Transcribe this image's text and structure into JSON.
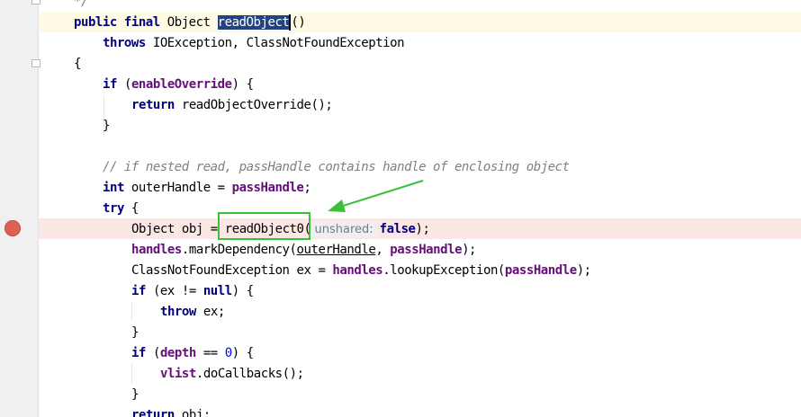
{
  "editor": {
    "lines": [
      {
        "indent": 1,
        "tokens": [
          {
            "t": "*/",
            "c": "cmt"
          }
        ]
      },
      {
        "indent": 1,
        "tokens": [
          {
            "t": "public",
            "c": "kw"
          },
          {
            "t": " "
          },
          {
            "t": "final",
            "c": "kw"
          },
          {
            "t": " Object "
          },
          {
            "t": "readObject",
            "c": "sel"
          },
          {
            "caret": true
          },
          {
            "t": "()"
          }
        ]
      },
      {
        "indent": 2,
        "tokens": [
          {
            "t": "throws",
            "c": "kw"
          },
          {
            "t": " IOException, ClassNotFoundException"
          }
        ]
      },
      {
        "indent": 1,
        "tokens": [
          {
            "t": "{"
          }
        ]
      },
      {
        "indent": 2,
        "tokens": [
          {
            "t": "if",
            "c": "kw"
          },
          {
            "t": " ("
          },
          {
            "t": "enableOverride",
            "c": "fld"
          },
          {
            "t": ") {"
          }
        ]
      },
      {
        "indent": 3,
        "tokens": [
          {
            "t": "return",
            "c": "kw"
          },
          {
            "t": " readObjectOverride();"
          }
        ]
      },
      {
        "indent": 2,
        "tokens": [
          {
            "t": "}"
          }
        ]
      },
      {
        "indent": 2,
        "tokens": []
      },
      {
        "indent": 2,
        "tokens": [
          {
            "t": "// if nested read, passHandle contains handle of enclosing object",
            "c": "cmt"
          }
        ]
      },
      {
        "indent": 2,
        "tokens": [
          {
            "t": "int",
            "c": "kw"
          },
          {
            "t": " outerHandle = "
          },
          {
            "t": "passHandle",
            "c": "fld"
          },
          {
            "t": ";"
          }
        ]
      },
      {
        "indent": 2,
        "tokens": [
          {
            "t": "try",
            "c": "kw"
          },
          {
            "t": " {"
          }
        ]
      },
      {
        "indent": 3,
        "tokens": [
          {
            "t": "Object obj = "
          },
          {
            "t": "readObject0("
          },
          {
            "hint": "unshared:"
          },
          {
            "t": "false",
            "c": "kw"
          },
          {
            "t": ");"
          }
        ]
      },
      {
        "indent": 3,
        "tokens": [
          {
            "t": "handles",
            "c": "fld"
          },
          {
            "t": ".markDependency("
          },
          {
            "t": "outerHandle",
            "c": "ul"
          },
          {
            "t": ", "
          },
          {
            "t": "passHandle",
            "c": "fld"
          },
          {
            "t": ");"
          }
        ]
      },
      {
        "indent": 3,
        "tokens": [
          {
            "t": "ClassNotFoundException ex = "
          },
          {
            "t": "handles",
            "c": "fld"
          },
          {
            "t": ".lookupException("
          },
          {
            "t": "passHandle",
            "c": "fld"
          },
          {
            "t": ");"
          }
        ]
      },
      {
        "indent": 3,
        "tokens": [
          {
            "t": "if",
            "c": "kw"
          },
          {
            "t": " (ex != "
          },
          {
            "t": "null",
            "c": "kw"
          },
          {
            "t": ") {"
          }
        ]
      },
      {
        "indent": 4,
        "tokens": [
          {
            "t": "throw",
            "c": "kw"
          },
          {
            "t": " ex;"
          }
        ]
      },
      {
        "indent": 3,
        "tokens": [
          {
            "t": "}"
          }
        ]
      },
      {
        "indent": 3,
        "tokens": [
          {
            "t": "if",
            "c": "kw"
          },
          {
            "t": " ("
          },
          {
            "t": "depth",
            "c": "fld"
          },
          {
            "t": " == "
          },
          {
            "t": "0",
            "c": "num"
          },
          {
            "t": ") {"
          }
        ]
      },
      {
        "indent": 4,
        "tokens": [
          {
            "t": "vlist",
            "c": "fld"
          },
          {
            "t": ".doCallbacks();"
          }
        ]
      },
      {
        "indent": 3,
        "tokens": [
          {
            "t": "}"
          }
        ]
      },
      {
        "indent": 3,
        "tokens": [
          {
            "t": "return",
            "c": "kw"
          },
          {
            "t": " obj;"
          }
        ]
      }
    ]
  },
  "gutter": {
    "breakpoint_line": 12,
    "breakpoint_icon": "breakpoint-dot-icon",
    "fold_icon": "fold-marker-icon"
  },
  "annotation": {
    "box_color": "#3ac13a",
    "arrow_color": "#3ac13a"
  },
  "colors": {
    "keyword": "#000080",
    "field": "#660e7a",
    "comment": "#808080",
    "number": "#0000ff",
    "selection": "#214283",
    "current_line": "#fffae3",
    "breakpoint_line": "#fbe8e5",
    "breakpoint": "#e05f5b"
  }
}
